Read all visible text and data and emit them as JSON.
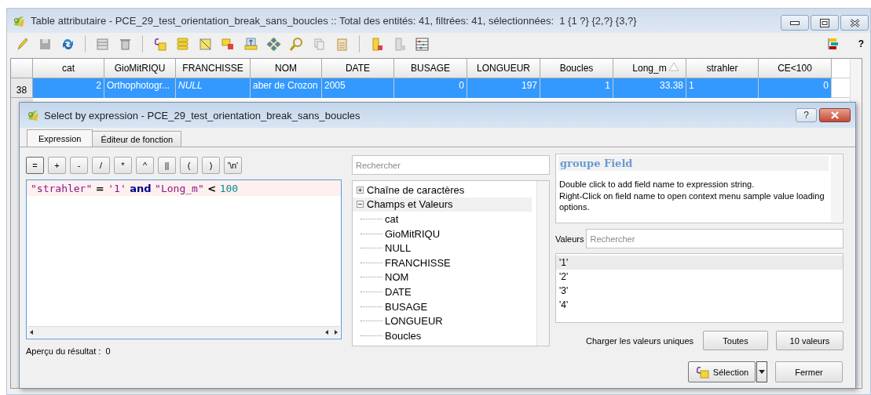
{
  "window": {
    "title": "Table attributaire - PCE_29_test_orientation_break_sans_boucles :: Total des entités: 41, filtrées: 41, sélectionnées:  1 {1 ?} {2,?} {3,?}",
    "help": "?"
  },
  "table": {
    "columns": [
      {
        "label": "cat",
        "sorted": false
      },
      {
        "label": "GioMitRIQU",
        "sorted": false
      },
      {
        "label": "FRANCHISSE",
        "sorted": false
      },
      {
        "label": "NOM",
        "sorted": false
      },
      {
        "label": "DATE",
        "sorted": false
      },
      {
        "label": "BUSAGE",
        "sorted": false
      },
      {
        "label": "LONGUEUR",
        "sorted": false
      },
      {
        "label": "Boucles",
        "sorted": false
      },
      {
        "label": "Long_m",
        "sorted": true
      },
      {
        "label": "strahler",
        "sorted": false
      },
      {
        "label": "CE<100",
        "sorted": false
      }
    ],
    "rows": [
      {
        "header": "38",
        "selected": true,
        "cells": [
          {
            "text": "2",
            "kind": "number"
          },
          {
            "text": "Orthophotogr...",
            "kind": "text"
          },
          {
            "text": "NULL",
            "kind": "null"
          },
          {
            "text": "aber de Crozon",
            "kind": "text"
          },
          {
            "text": "2005",
            "kind": "text"
          },
          {
            "text": "0",
            "kind": "number"
          },
          {
            "text": "197",
            "kind": "number"
          },
          {
            "text": "1",
            "kind": "number"
          },
          {
            "text": "33.38",
            "kind": "number"
          },
          {
            "text": "1",
            "kind": "text"
          },
          {
            "text": "0",
            "kind": "number"
          }
        ]
      }
    ]
  },
  "dialog": {
    "title": "Select by expression - PCE_29_test_orientation_break_sans_boucles",
    "help": "?",
    "tabs": [
      {
        "label": "Expression",
        "selected": true
      },
      {
        "label": "Éditeur de fonction",
        "selected": false
      }
    ],
    "operators": [
      "=",
      "+",
      "-",
      "/",
      "*",
      "^",
      "||",
      "(",
      ")",
      "'\\n'"
    ],
    "expression": [
      {
        "text": "\"strahler\"",
        "kind": "field"
      },
      {
        "text": " = ",
        "kind": "operator"
      },
      {
        "text": "'1'",
        "kind": "string"
      },
      {
        "text": " and ",
        "kind": "keyword"
      },
      {
        "text": "\"Long_m\"",
        "kind": "field"
      },
      {
        "text": " < ",
        "kind": "operator"
      },
      {
        "text": "100",
        "kind": "number"
      }
    ],
    "preview": {
      "label": "Aperçu du résultat :",
      "value": "0"
    },
    "function_search": {
      "placeholder": "Rechercher"
    },
    "tree": [
      {
        "label": "Chaîne de caractères",
        "expanded": false,
        "selected": false
      },
      {
        "label": "Champs et Valeurs",
        "expanded": true,
        "selected": true,
        "children": [
          {
            "label": "cat",
            "selected": false
          },
          {
            "label": "GioMitRIQU",
            "selected": false
          },
          {
            "label": "NULL",
            "selected": false
          },
          {
            "label": "FRANCHISSE",
            "selected": false
          },
          {
            "label": "NOM",
            "selected": false
          },
          {
            "label": "DATE",
            "selected": false
          },
          {
            "label": "BUSAGE",
            "selected": false
          },
          {
            "label": "LONGUEUR",
            "selected": false
          },
          {
            "label": "Boucles",
            "selected": false
          }
        ]
      }
    ],
    "help_panel": {
      "title": "groupe Field",
      "lines": [
        "Double click to add field name to expression string.",
        "Right-Click on field name to open context menu sample value loading options."
      ]
    },
    "values": {
      "label": "Valeurs",
      "placeholder": "Rechercher",
      "items": [
        {
          "text": "'1'",
          "selected": true
        },
        {
          "text": "'2'",
          "selected": false
        },
        {
          "text": "'3'",
          "selected": false
        },
        {
          "text": "'4'",
          "selected": false
        }
      ]
    },
    "load_unique": {
      "label": "Charger les valeurs uniques",
      "buttons": [
        "Toutes",
        "10 valeurs"
      ]
    },
    "buttons": {
      "select": "Sélection",
      "close": "Fermer"
    }
  }
}
